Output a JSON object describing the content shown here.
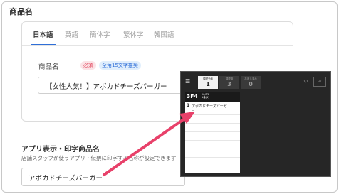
{
  "section": {
    "title": "商品名"
  },
  "tabs": [
    {
      "label": "日本語",
      "active": true
    },
    {
      "label": "英語",
      "active": false
    },
    {
      "label": "簡体字",
      "active": false
    },
    {
      "label": "繁体字",
      "active": false
    },
    {
      "label": "韓国語",
      "active": false
    }
  ],
  "name_field": {
    "label": "商品名",
    "required_badge": "必須",
    "limit_badge": "全角15文字推奨",
    "value": "【女性人気！】アボカドチーズバーガー"
  },
  "app_print": {
    "title": "アプリ表示・印字商品名",
    "description": "店舗スタッフが使うアプリ・伝票に印字する名称が設定できます",
    "value": "アボカドチーズバーガー"
  },
  "preview": {
    "menu_icon": "hamburger-menu-icon",
    "tabs": [
      {
        "title": "調理予約",
        "count": "1",
        "active": true
      },
      {
        "title": "調理済",
        "count": "3",
        "active": false
      },
      {
        "title": "お渡し済み",
        "count": "0",
        "active": false
      }
    ],
    "page_indicator": "1/1",
    "box_label": "HK",
    "ticket": {
      "number": "3F4",
      "time_line1": "10/13",
      "time_line2": "1番(1)",
      "quantity": "1",
      "item_name": "アボカドチーズバーガ",
      "sub_text": "ー"
    }
  },
  "colors": {
    "accent": "#2f6fd8",
    "arrow": "#e8416a",
    "required": "#e03a52",
    "overlay_bg": "#262626"
  }
}
